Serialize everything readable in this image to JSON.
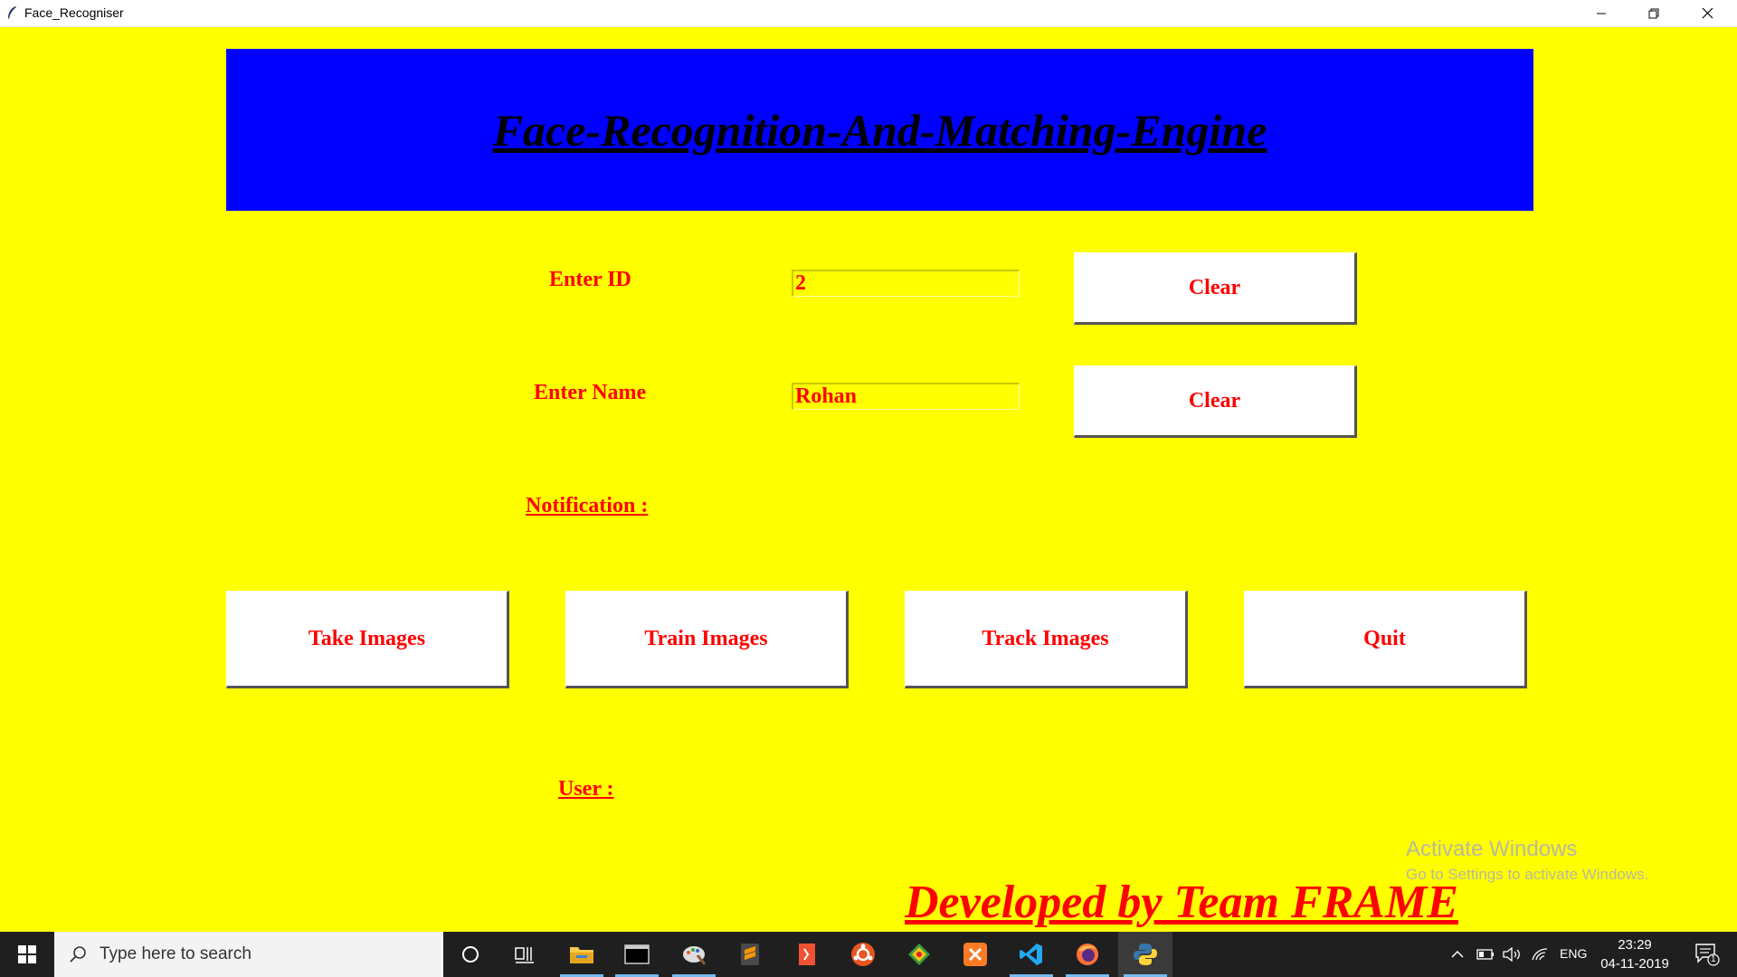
{
  "window": {
    "title": "Face_Recogniser"
  },
  "banner": {
    "title": "Face-Recognition-And-Matching-Engine"
  },
  "form": {
    "id_label": "Enter ID",
    "id_value": "2",
    "name_label": "Enter Name",
    "name_value": "Rohan",
    "clear_id_label": "Clear",
    "clear_name_label": "Clear",
    "notification_label": "Notification :",
    "user_label": "User :"
  },
  "actions": {
    "take_images": "Take Images",
    "train_images": "Train Images",
    "track_images": "Track Images",
    "quit": "Quit"
  },
  "footer": {
    "credit": "Developed by Team FRAME"
  },
  "watermark": {
    "line1": "Activate Windows",
    "line2": "Go to Settings to activate Windows."
  },
  "taskbar": {
    "search_placeholder": "Type here to search",
    "pinned_icons": [
      "cortana-icon",
      "task-view-icon",
      "file-explorer-icon",
      "terminal-icon",
      "paint-icon",
      "sublime-text-icon",
      "git-icon",
      "ubuntu-icon",
      "sourcetree-icon",
      "xampp-icon",
      "vscode-icon",
      "firefox-icon",
      "python-icon"
    ],
    "language": "ENG",
    "time": "23:29",
    "date": "04-11-2019",
    "notification_count": "1"
  },
  "colors": {
    "background": "#ffff00",
    "banner": "#0000ff",
    "text_accent": "#ff0000",
    "button": "#ffffff"
  }
}
